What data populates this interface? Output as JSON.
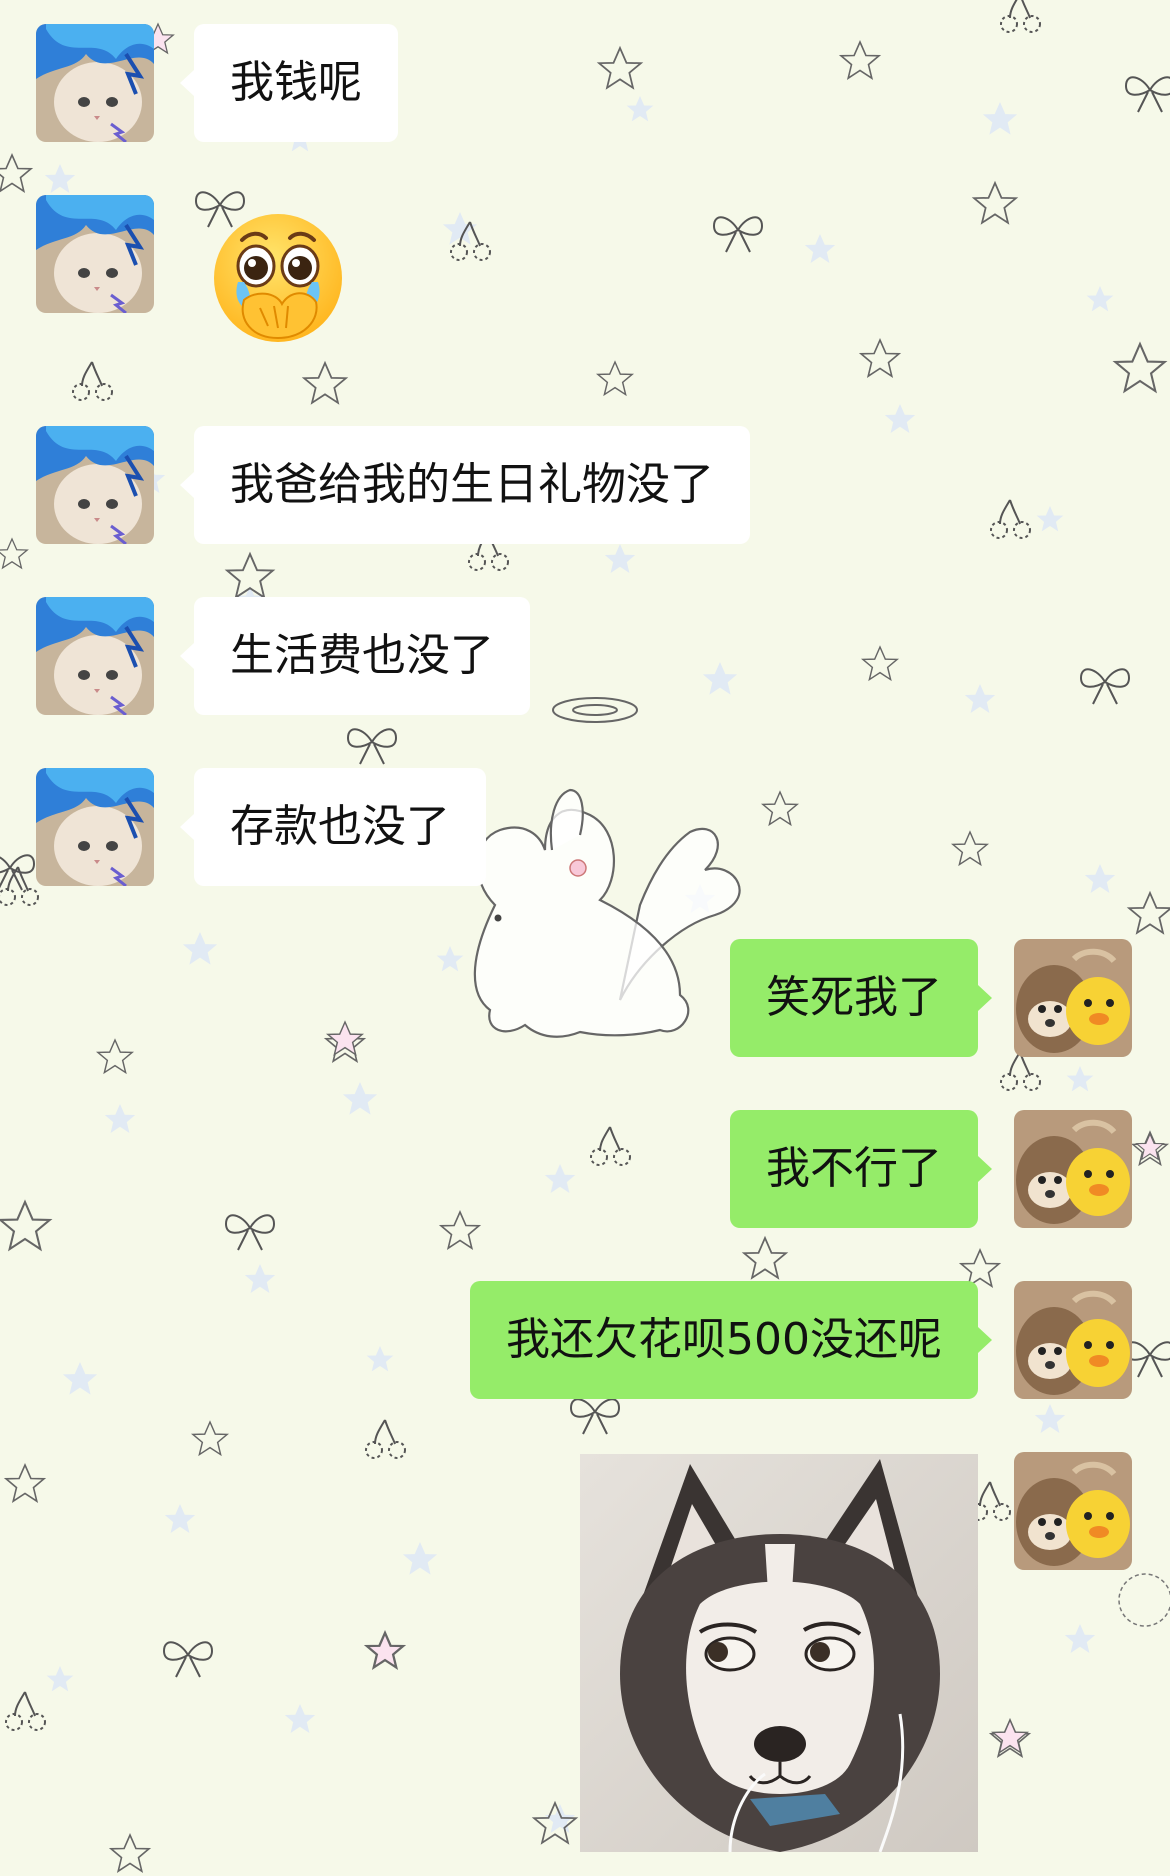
{
  "chat": {
    "incoming": [
      {
        "type": "text",
        "text": "我钱呢"
      },
      {
        "type": "sticker",
        "icon": "crying-face-emoji"
      },
      {
        "type": "text",
        "text": "我爸给我的生日礼物没了"
      },
      {
        "type": "text",
        "text": "生活费也没了"
      },
      {
        "type": "text",
        "text": "存款也没了"
      }
    ],
    "outgoing": [
      {
        "type": "text",
        "text": "笑死我了"
      },
      {
        "type": "text",
        "text": "我不行了"
      },
      {
        "type": "text",
        "text": "我还欠花呗500没还呢"
      },
      {
        "type": "image",
        "icon": "side-eye-husky-dog-photo"
      }
    ]
  },
  "avatars": {
    "contact": "cat-with-blue-hair-avatar",
    "self": "plush-bear-and-chick-avatar"
  },
  "colors": {
    "background": "#f6f9e9",
    "incoming_bubble": "#ffffff",
    "outgoing_bubble": "#95ec69",
    "text": "#111111"
  }
}
